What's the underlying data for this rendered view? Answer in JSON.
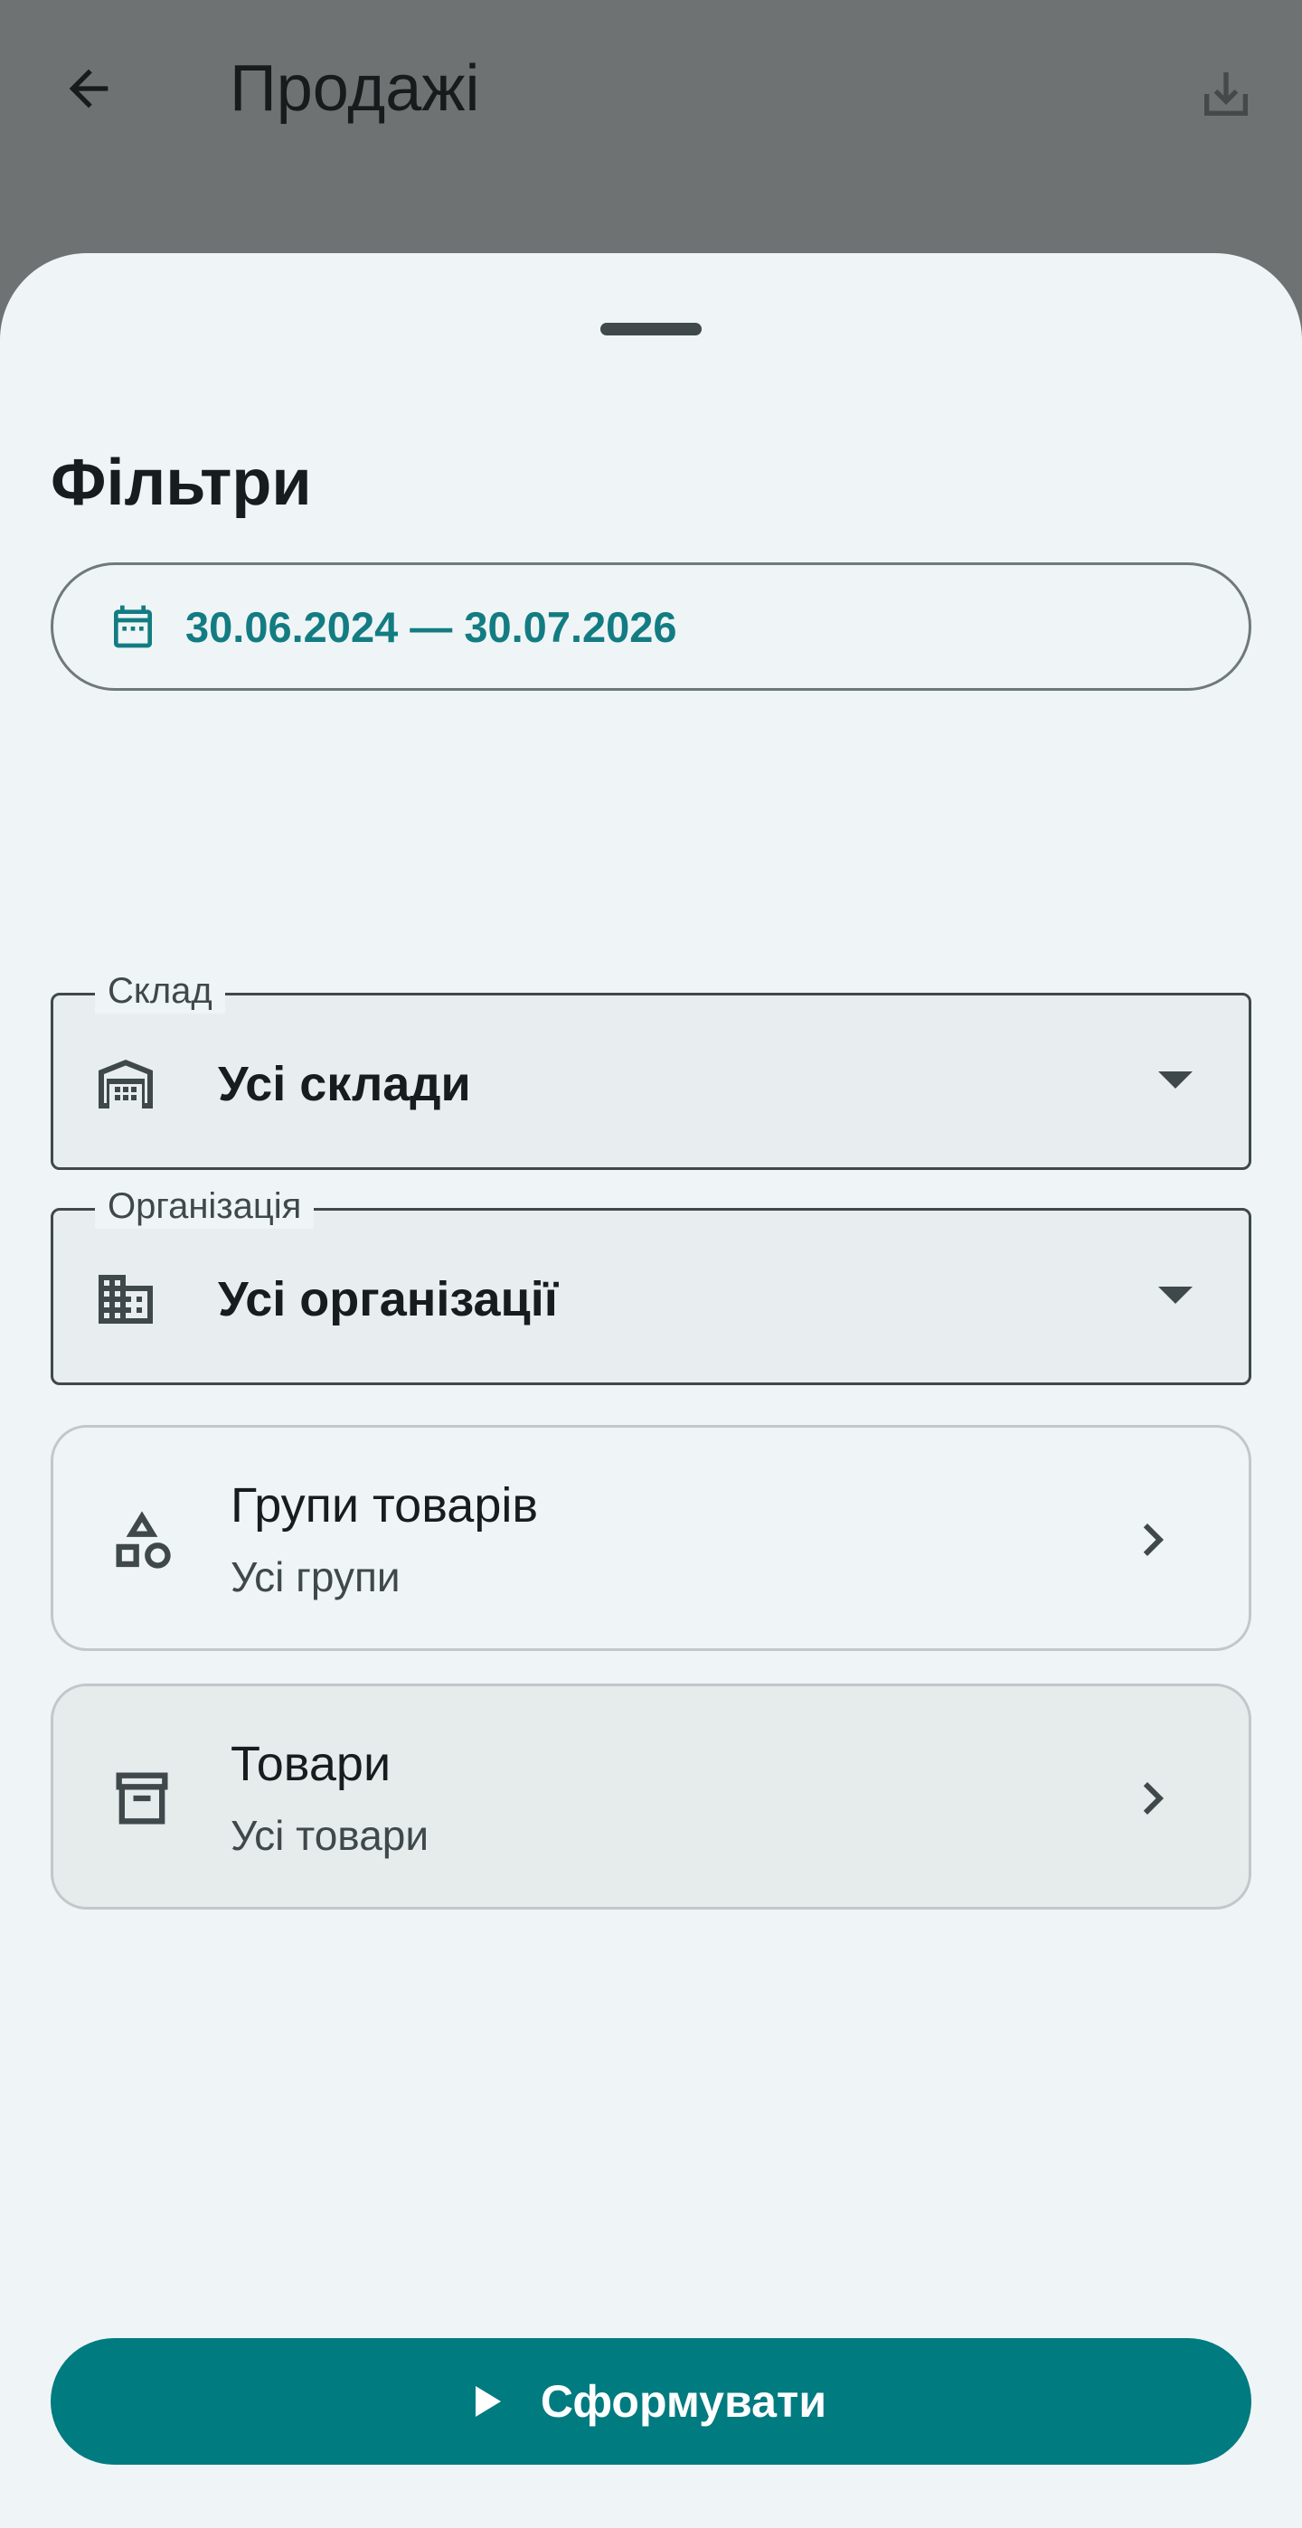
{
  "app_bar": {
    "title": "Продажі",
    "back_icon": "arrow-back-icon",
    "action_icon": "download-icon"
  },
  "sheet": {
    "title": "Фільтри",
    "date_range": {
      "icon": "calendar-icon",
      "value": "30.06.2024 — 30.07.2026"
    },
    "warehouse": {
      "label": "Склад",
      "icon": "warehouse-icon",
      "value": "Усі склади"
    },
    "organization": {
      "label": "Організація",
      "icon": "building-icon",
      "value": "Усі організації"
    },
    "product_groups": {
      "icon": "category-shapes-icon",
      "title": "Групи товарів",
      "subtitle": "Усі групи"
    },
    "products": {
      "icon": "archive-box-icon",
      "title": "Товари",
      "subtitle": "Усі товари"
    },
    "generate_button": {
      "icon": "play-icon",
      "label": "Сформувати"
    }
  },
  "colors": {
    "accent": "#007b80",
    "sheet_background": "#eff5f6",
    "scrim": "#6f7273"
  }
}
